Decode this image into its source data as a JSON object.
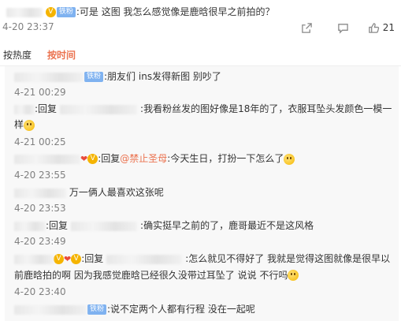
{
  "top_comment": {
    "badge": "铁粉",
    "text": ":可是 这图 我怎么感觉像是鹿晗很早之前拍的？",
    "time": "4-20 23:37",
    "likes": "21",
    "icons": [
      "share-icon",
      "comment-icon",
      "like-icon"
    ]
  },
  "sort": {
    "by_hot": "按热度",
    "by_time": "按时间"
  },
  "replies": [
    {
      "badge": "铁粉",
      "text": ":朋友们 ins发得新图 别吵了",
      "time": "4-21 00:29"
    },
    {
      "prefix": ":回复",
      "text": ":我看粉丝发的图好像是18年的了，衣服耳坠头发颜色一模一样",
      "time": "4-21 00:25"
    },
    {
      "prefix": ":回复",
      "mention": "@禁止圣母",
      "text": ":今天生日，打扮一下怎么了",
      "time": "4-20 23:55"
    },
    {
      "text": "万一俩人最喜欢这张呢",
      "time": "4-20 23:53"
    },
    {
      "prefix": ":回复",
      "text": ":确实挺早之前的了，鹿哥最近不是这风格",
      "time": "4-20 23:49"
    },
    {
      "prefix": ":回复",
      "text": ":怎么就见不得好了 我就是觉得这图就像是很早以前鹿晗拍的啊 因为我感觉鹿晗已经很久没带过耳坠了 说说 不行吗",
      "time": "4-20 23:40"
    },
    {
      "badge": "铁粉",
      "text": ":说不定两个人都有行程 没在一起呢"
    }
  ]
}
